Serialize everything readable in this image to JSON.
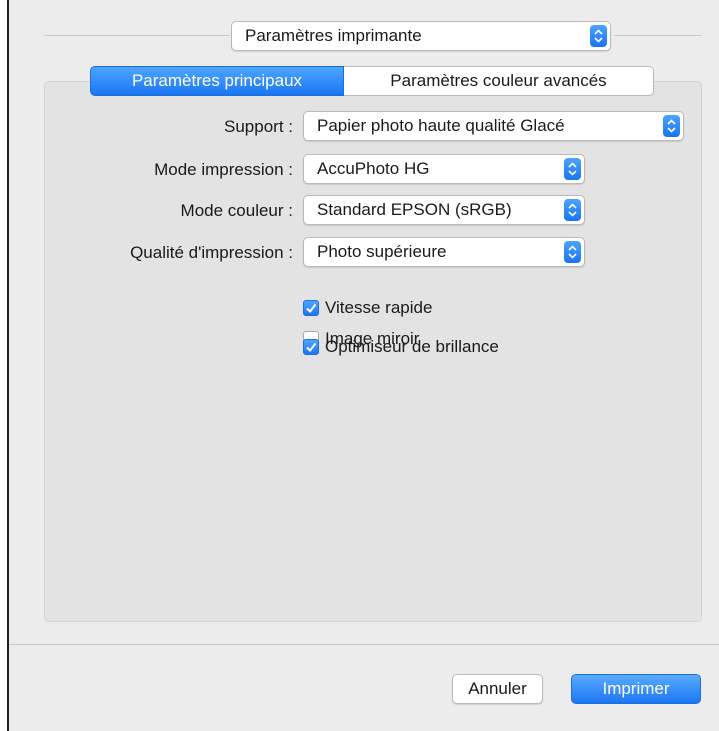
{
  "header": {
    "preset_value": "Paramètres imprimante"
  },
  "tabs": [
    {
      "label": "Paramètres principaux",
      "active": true
    },
    {
      "label": "Paramètres couleur avancés",
      "active": false
    }
  ],
  "fields": {
    "support": {
      "label": "Support :",
      "value": "Papier photo haute qualité Glacé"
    },
    "mode_impression": {
      "label": "Mode impression :",
      "value": "AccuPhoto HG"
    },
    "mode_couleur": {
      "label": "Mode couleur :",
      "value": "Standard EPSON (sRGB)"
    },
    "qualite": {
      "label": "Qualité d'impression :",
      "value": "Photo supérieure"
    }
  },
  "checkboxes": [
    {
      "label": "Vitesse rapide",
      "checked": true
    },
    {
      "label": "Image miroir",
      "checked": false
    },
    {
      "label": "Optimiseur de brillance",
      "checked": true
    }
  ],
  "buttons": {
    "cancel": "Annuler",
    "print": "Imprimer"
  },
  "colors": {
    "accent": "#1b76f2",
    "window_bg": "#ececec",
    "panel_bg": "#e3e3e3"
  },
  "icons": {
    "popup_arrows": "updown-chevron-icon",
    "checkmark": "checkmark-icon"
  }
}
